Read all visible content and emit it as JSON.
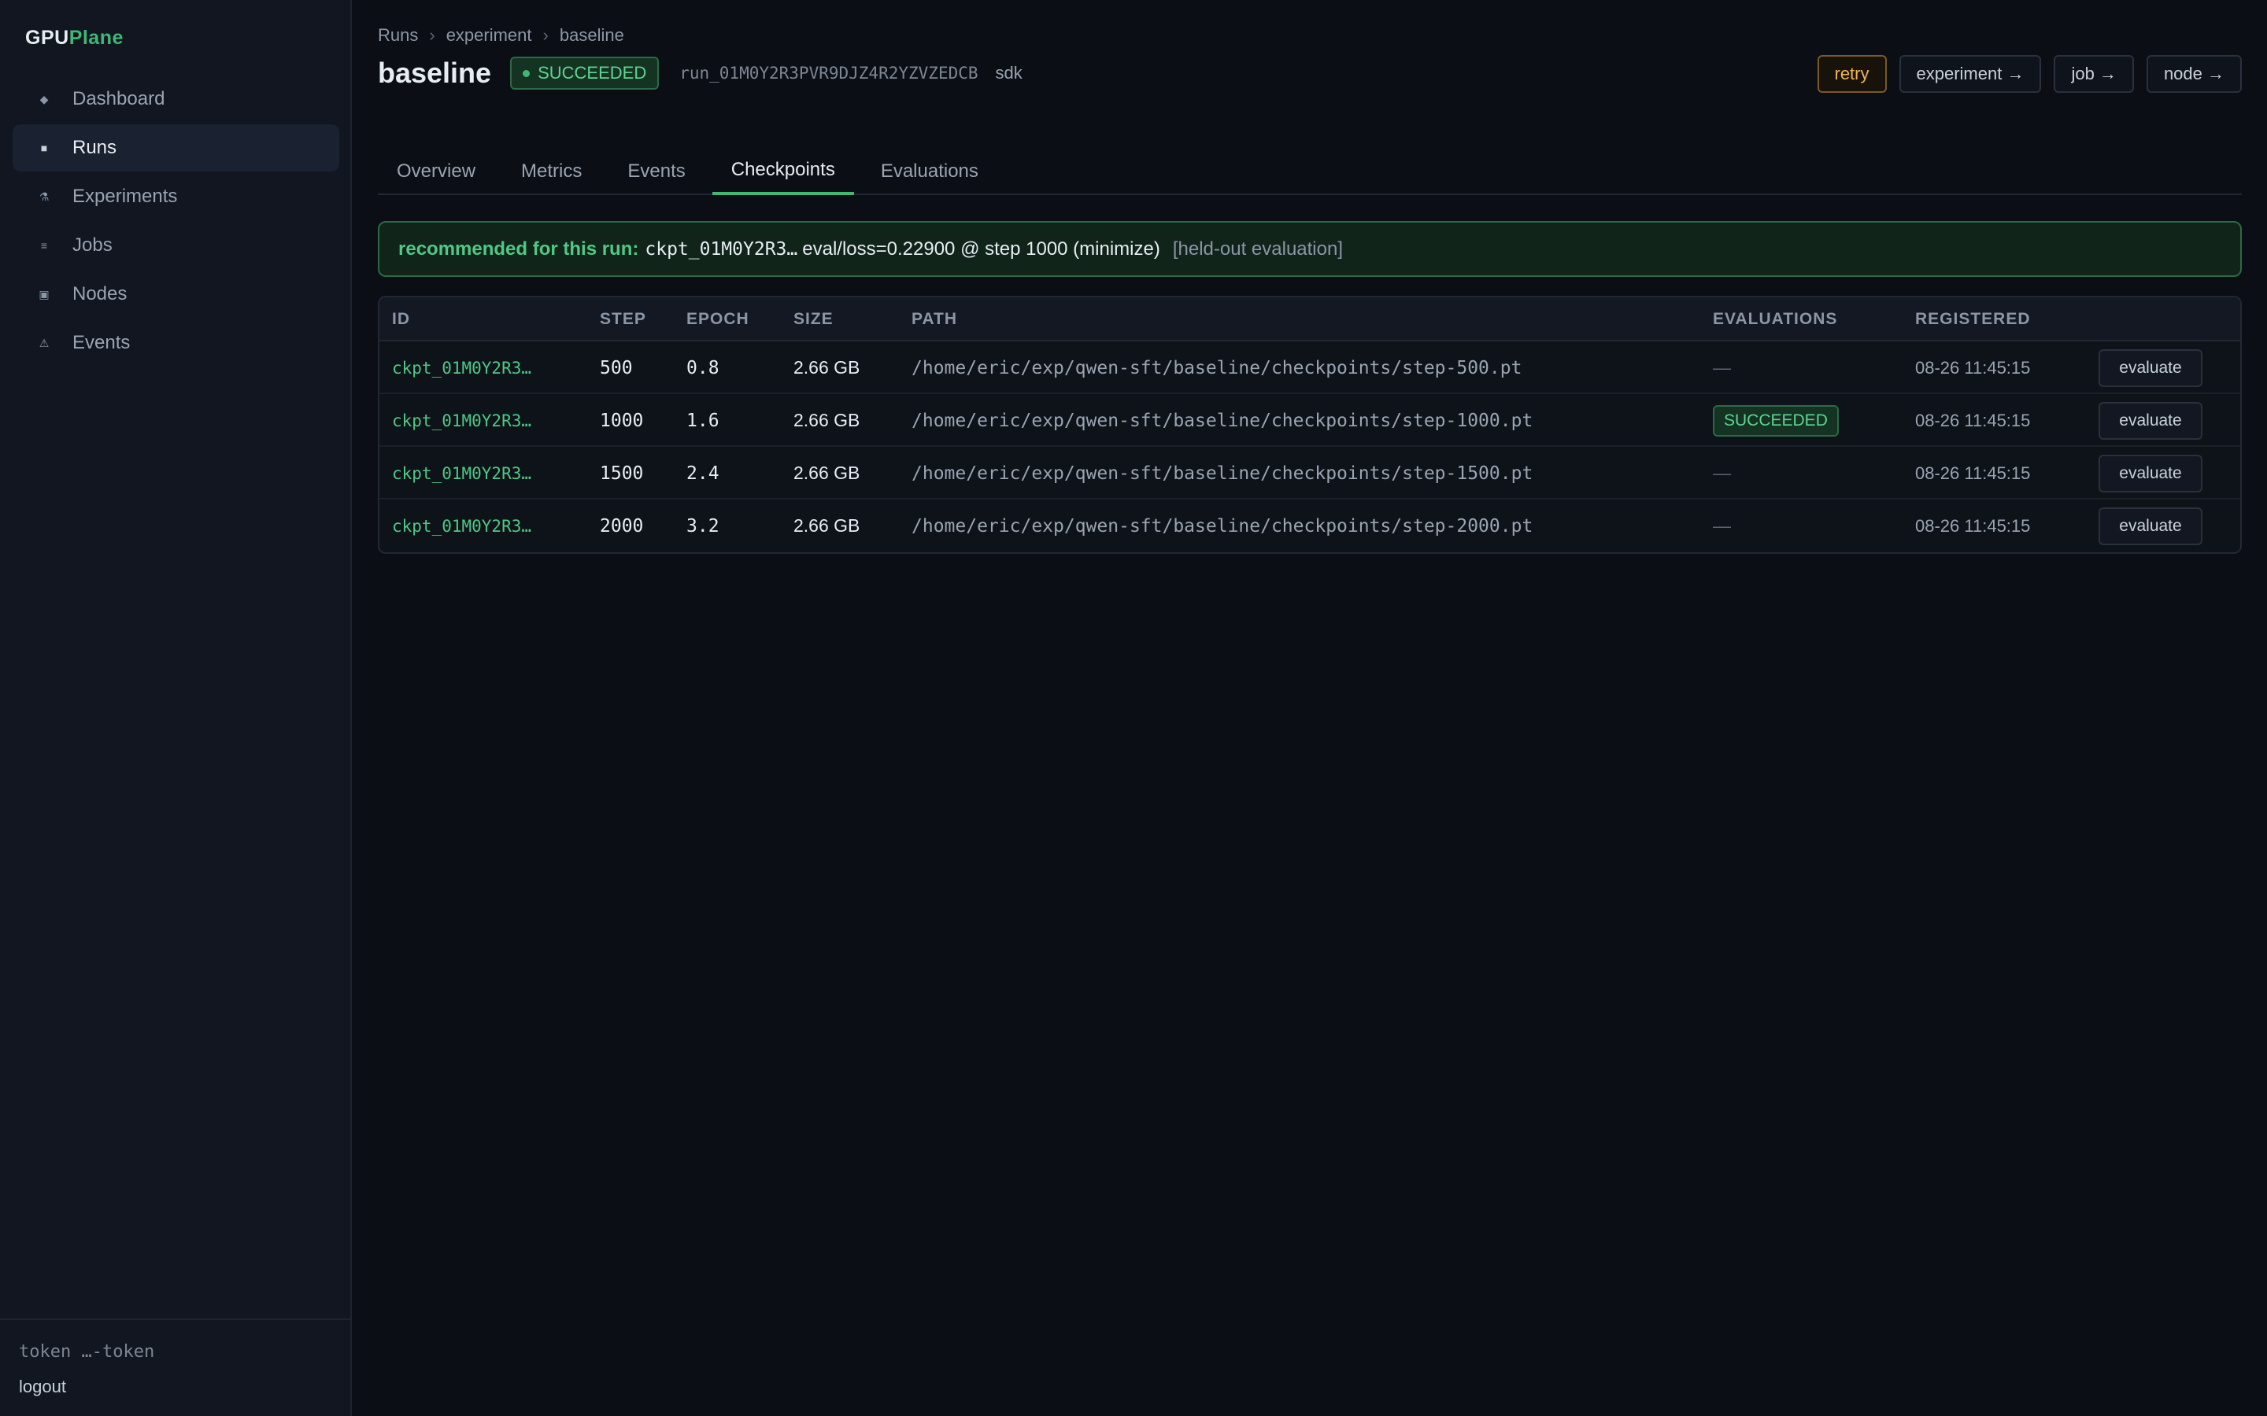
{
  "brand": {
    "part1": "GPU",
    "part2": "Plane"
  },
  "sidebar": {
    "items": [
      {
        "label": "Dashboard",
        "icon": "diamond-icon",
        "glyph": "◆",
        "active": false
      },
      {
        "label": "Runs",
        "icon": "square-icon",
        "glyph": "■",
        "active": true
      },
      {
        "label": "Experiments",
        "icon": "flask-icon",
        "glyph": "⚗",
        "active": false
      },
      {
        "label": "Jobs",
        "icon": "list-icon",
        "glyph": "≡",
        "active": false
      },
      {
        "label": "Nodes",
        "icon": "node-icon",
        "glyph": "▣",
        "active": false
      },
      {
        "label": "Events",
        "icon": "warning-icon",
        "glyph": "⚠",
        "active": false
      }
    ],
    "token": "token …-token",
    "logout": "logout"
  },
  "breadcrumb": {
    "runs": "Runs",
    "experiment": "experiment",
    "current": "baseline",
    "sep": "›"
  },
  "header": {
    "title": "baseline",
    "status": "SUCCEEDED",
    "run_id": "run_01M0Y2R3PVR9DJZ4R2YZVZEDCB",
    "source": "sdk"
  },
  "actions": {
    "retry": "retry",
    "experiment": "experiment →",
    "job": "job →",
    "node": "node →"
  },
  "tabs": [
    "Overview",
    "Metrics",
    "Events",
    "Checkpoints",
    "Evaluations"
  ],
  "active_tab": "Checkpoints",
  "recommendation": {
    "label": "recommended for this run:",
    "checkpoint": "ckpt_01M0Y2R3…",
    "metric": "eval/loss=0.22900 @ step 1000 (minimize)",
    "note": "[held-out evaluation]"
  },
  "table": {
    "columns": [
      "ID",
      "STEP",
      "EPOCH",
      "SIZE",
      "PATH",
      "EVALUATIONS",
      "REGISTERED"
    ],
    "evaluate_label": "evaluate",
    "rows": [
      {
        "id": "ckpt_01M0Y2R3…",
        "step": "500",
        "epoch": "0.8",
        "size": "2.66 GB",
        "path": "/home/eric/exp/qwen-sft/baseline/checkpoints/step-500.pt",
        "evaluations": "—",
        "registered": "08-26 11:45:15"
      },
      {
        "id": "ckpt_01M0Y2R3…",
        "step": "1000",
        "epoch": "1.6",
        "size": "2.66 GB",
        "path": "/home/eric/exp/qwen-sft/baseline/checkpoints/step-1000.pt",
        "evaluations": "SUCCEEDED",
        "registered": "08-26 11:45:15"
      },
      {
        "id": "ckpt_01M0Y2R3…",
        "step": "1500",
        "epoch": "2.4",
        "size": "2.66 GB",
        "path": "/home/eric/exp/qwen-sft/baseline/checkpoints/step-1500.pt",
        "evaluations": "—",
        "registered": "08-26 11:45:15"
      },
      {
        "id": "ckpt_01M0Y2R3…",
        "step": "2000",
        "epoch": "3.2",
        "size": "2.66 GB",
        "path": "/home/eric/exp/qwen-sft/baseline/checkpoints/step-2000.pt",
        "evaluations": "—",
        "registered": "08-26 11:45:15"
      }
    ]
  },
  "colors": {
    "accent": "#3fb874",
    "background": "#0b0e14",
    "sidebar": "#111620",
    "warning": "#f0b450"
  }
}
